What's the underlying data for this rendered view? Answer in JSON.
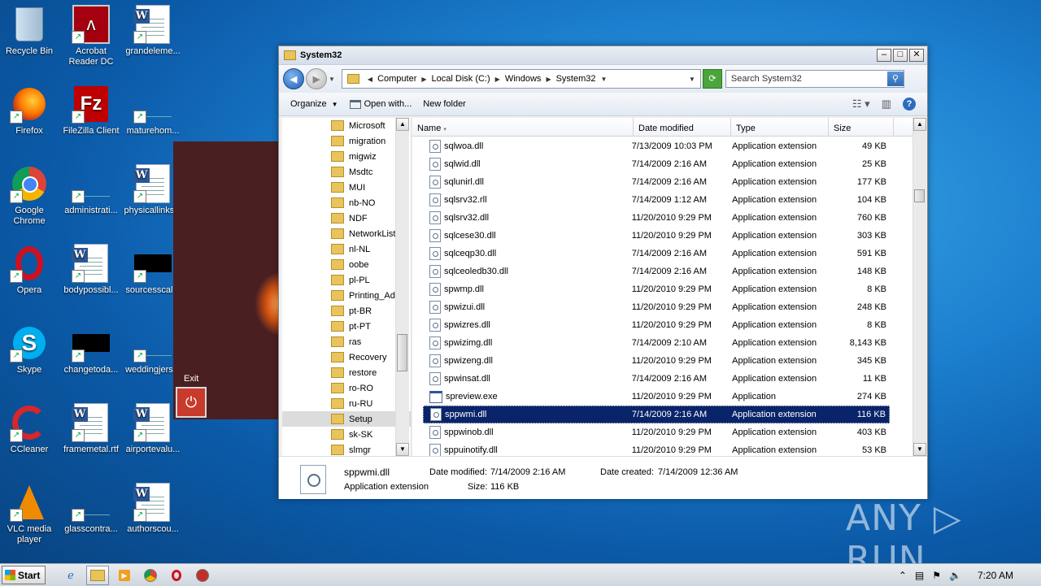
{
  "desktop": {
    "icons": [
      {
        "label": "Recycle Bin"
      },
      {
        "label": "Acrobat Reader DC"
      },
      {
        "label": "grandeleme..."
      },
      {
        "label": "Firefox"
      },
      {
        "label": "FileZilla Client"
      },
      {
        "label": "maturehom..."
      },
      {
        "label": "Google Chrome"
      },
      {
        "label": "administrati..."
      },
      {
        "label": "physicallinks..."
      },
      {
        "label": "Opera"
      },
      {
        "label": "bodypossibl..."
      },
      {
        "label": "sourcesscal..."
      },
      {
        "label": "Skype"
      },
      {
        "label": "changetoda..."
      },
      {
        "label": "weddingjers..."
      },
      {
        "label": "CCleaner"
      },
      {
        "label": "framemetal.rtf"
      },
      {
        "label": "airportevalu..."
      },
      {
        "label": "VLC media player"
      },
      {
        "label": "glasscontra..."
      },
      {
        "label": "authorscou..."
      }
    ],
    "watermark": "ANY ▷ RUN"
  },
  "bgapp": {
    "exit_label": "Exit",
    "exit_icon": "power-icon"
  },
  "window": {
    "title": "System32",
    "address": {
      "crumbs": [
        "Computer",
        "Local Disk (C:)",
        "Windows",
        "System32"
      ]
    },
    "search_placeholder": "Search System32",
    "toolbar": {
      "organize": "Organize",
      "open_with": "Open with...",
      "new_folder": "New folder"
    },
    "nav_folders": [
      "Microsoft",
      "migration",
      "migwiz",
      "Msdtc",
      "MUI",
      "nb-NO",
      "NDF",
      "NetworkList",
      "nl-NL",
      "oobe",
      "pl-PL",
      "Printing_Adm",
      "pt-BR",
      "pt-PT",
      "ras",
      "Recovery",
      "restore",
      "ro-RO",
      "ru-RU",
      "Setup",
      "sk-SK",
      "slmgr"
    ],
    "nav_selected": "Setup",
    "columns": {
      "name": "Name",
      "date": "Date modified",
      "type": "Type",
      "size": "Size"
    },
    "files": [
      {
        "name": "sqlwoa.dll",
        "date": "7/13/2009 10:03 PM",
        "type": "Application extension",
        "size": "49 KB",
        "kind": "dll"
      },
      {
        "name": "sqlwid.dll",
        "date": "7/14/2009 2:16 AM",
        "type": "Application extension",
        "size": "25 KB",
        "kind": "dll"
      },
      {
        "name": "sqlunirl.dll",
        "date": "7/14/2009 2:16 AM",
        "type": "Application extension",
        "size": "177 KB",
        "kind": "dll"
      },
      {
        "name": "sqlsrv32.rll",
        "date": "7/14/2009 1:12 AM",
        "type": "Application extension",
        "size": "104 KB",
        "kind": "dll"
      },
      {
        "name": "sqlsrv32.dll",
        "date": "11/20/2010 9:29 PM",
        "type": "Application extension",
        "size": "760 KB",
        "kind": "dll"
      },
      {
        "name": "sqlcese30.dll",
        "date": "11/20/2010 9:29 PM",
        "type": "Application extension",
        "size": "303 KB",
        "kind": "dll"
      },
      {
        "name": "sqlceqp30.dll",
        "date": "7/14/2009 2:16 AM",
        "type": "Application extension",
        "size": "591 KB",
        "kind": "dll"
      },
      {
        "name": "sqlceoledb30.dll",
        "date": "7/14/2009 2:16 AM",
        "type": "Application extension",
        "size": "148 KB",
        "kind": "dll"
      },
      {
        "name": "spwmp.dll",
        "date": "11/20/2010 9:29 PM",
        "type": "Application extension",
        "size": "8 KB",
        "kind": "dll"
      },
      {
        "name": "spwizui.dll",
        "date": "11/20/2010 9:29 PM",
        "type": "Application extension",
        "size": "248 KB",
        "kind": "dll"
      },
      {
        "name": "spwizres.dll",
        "date": "11/20/2010 9:29 PM",
        "type": "Application extension",
        "size": "8 KB",
        "kind": "dll"
      },
      {
        "name": "spwizimg.dll",
        "date": "7/14/2009 2:10 AM",
        "type": "Application extension",
        "size": "8,143 KB",
        "kind": "dll"
      },
      {
        "name": "spwizeng.dll",
        "date": "11/20/2010 9:29 PM",
        "type": "Application extension",
        "size": "345 KB",
        "kind": "dll"
      },
      {
        "name": "spwinsat.dll",
        "date": "7/14/2009 2:16 AM",
        "type": "Application extension",
        "size": "11 KB",
        "kind": "dll"
      },
      {
        "name": "spreview.exe",
        "date": "11/20/2010 9:29 PM",
        "type": "Application",
        "size": "274 KB",
        "kind": "exe"
      },
      {
        "name": "sppwmi.dll",
        "date": "7/14/2009 2:16 AM",
        "type": "Application extension",
        "size": "116 KB",
        "kind": "dll",
        "selected": true
      },
      {
        "name": "sppwinob.dll",
        "date": "11/20/2010 9:29 PM",
        "type": "Application extension",
        "size": "403 KB",
        "kind": "dll"
      },
      {
        "name": "sppuinotify.dll",
        "date": "11/20/2010 9:29 PM",
        "type": "Application extension",
        "size": "53 KB",
        "kind": "dll"
      }
    ],
    "details": {
      "name": "sppwmi.dll",
      "type": "Application extension",
      "modified_label": "Date modified:",
      "modified": "7/14/2009 2:16 AM",
      "created_label": "Date created:",
      "created": "7/14/2009 12:36 AM",
      "size_label": "Size:",
      "size": "116 KB"
    }
  },
  "taskbar": {
    "start": "Start",
    "clock": "7:20 AM"
  }
}
